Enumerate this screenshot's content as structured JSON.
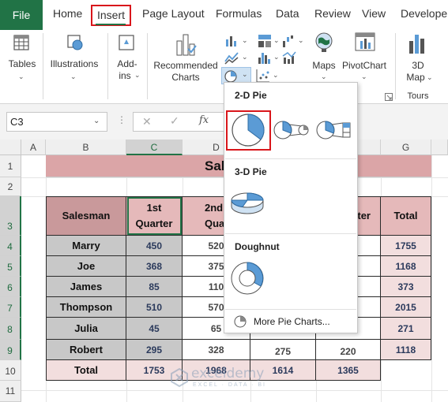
{
  "ribbon_tabs": {
    "file": "File",
    "home": "Home",
    "insert": "Insert",
    "page_layout": "Page Layout",
    "formulas": "Formulas",
    "data": "Data",
    "review": "Review",
    "view": "View",
    "developer": "Developer"
  },
  "ribbon": {
    "tables": "Tables",
    "illustrations": "Illustrations",
    "addins_line1": "Add-",
    "addins_line2": "ins",
    "recommended_line1": "Recommended",
    "recommended_line2": "Charts",
    "maps": "Maps",
    "pivotchart": "PivotChart",
    "map3d_line1": "3D",
    "map3d_line2": "Map",
    "tours": "Tours"
  },
  "formula_bar": {
    "name_box": "C3",
    "fx": "fx",
    "cancel": "✕",
    "enter": "✓"
  },
  "columns": [
    "A",
    "B",
    "C",
    "D",
    "G"
  ],
  "rows": [
    "1",
    "2",
    "3",
    "4",
    "5",
    "6",
    "7",
    "8",
    "9",
    "10",
    "11"
  ],
  "sheet": {
    "title": "Sales Data",
    "headers": {
      "salesman": "Salesman",
      "q1_line1": "1st",
      "q1_line2": "Quarter",
      "q2_line1": "2nd",
      "q2_line2": "Quar",
      "q4_partial": "ter",
      "total": "Total"
    },
    "data": [
      {
        "name": "Marry",
        "q1": "450",
        "q2": "520",
        "q3": "",
        "q4": "",
        "total": "1755"
      },
      {
        "name": "Joe",
        "q1": "368",
        "q2": "375",
        "q3": "",
        "q4": "",
        "total": "1168"
      },
      {
        "name": "James",
        "q1": "85",
        "q2": "110",
        "q3": "",
        "q4": "",
        "total": "373"
      },
      {
        "name": "Thompson",
        "q1": "510",
        "q2": "570",
        "q3": "",
        "q4": "",
        "total": "2015"
      },
      {
        "name": "Julia",
        "q1": "45",
        "q2": "65",
        "q3": "",
        "q4": "",
        "total": "271"
      },
      {
        "name": "Robert",
        "q1": "295",
        "q2": "328",
        "q3": "275",
        "q4": "220",
        "total": "1118"
      }
    ],
    "total_row": {
      "label": "Total",
      "q1": "1753",
      "q2": "1968",
      "q3": "1614",
      "q4": "1365"
    }
  },
  "pie_menu": {
    "section_2d": "2-D Pie",
    "section_3d": "3-D Pie",
    "section_doughnut": "Doughnut",
    "more": "More Pie Charts..."
  },
  "watermark": {
    "name": "exceldemy",
    "tagline": "EXCEL · DATA · BI"
  },
  "colors": {
    "excel_green": "#217346",
    "highlight_red": "#d9161b",
    "pie_blue": "#5b9bd5",
    "title_fill": "#dba5a7"
  }
}
